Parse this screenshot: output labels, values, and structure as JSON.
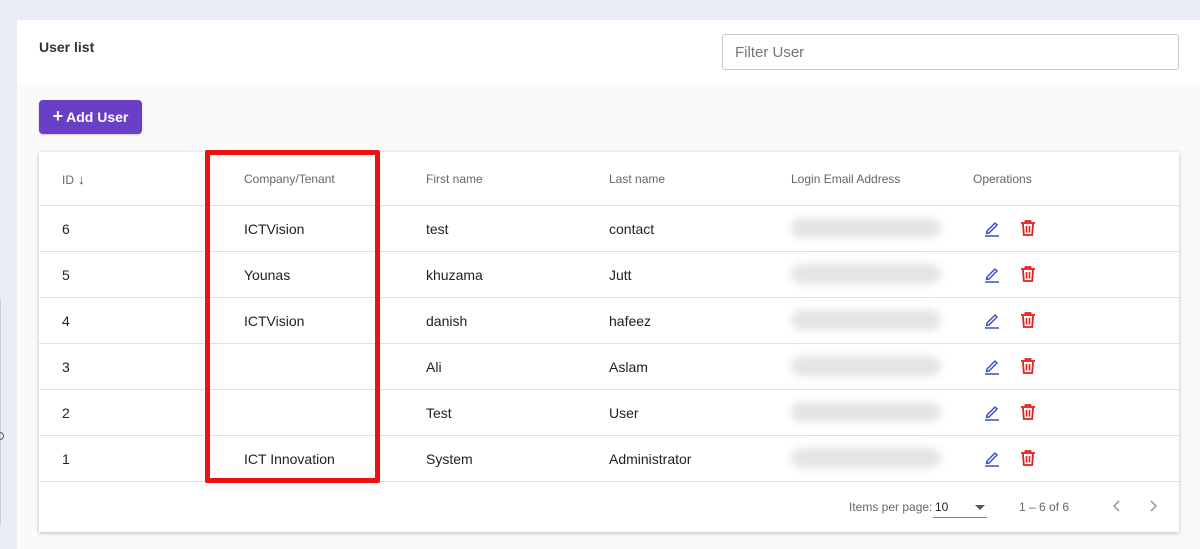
{
  "page": {
    "title": "User list"
  },
  "filter": {
    "placeholder": "Filter User"
  },
  "add_button": {
    "label": "Add User"
  },
  "table": {
    "headers": {
      "id": "ID",
      "company": "Company/Tenant",
      "first_name": "First name",
      "last_name": "Last name",
      "email": "Login Email Address",
      "operations": "Operations"
    },
    "sort_icon": "arrow-down-icon",
    "rows": [
      {
        "id": "6",
        "company": "ICTVision",
        "first_name": "test",
        "last_name": "contact"
      },
      {
        "id": "5",
        "company": "Younas",
        "first_name": "khuzama",
        "last_name": "Jutt"
      },
      {
        "id": "4",
        "company": "ICTVision",
        "first_name": "danish",
        "last_name": "hafeez"
      },
      {
        "id": "3",
        "company": "",
        "first_name": "Ali",
        "last_name": "Aslam"
      },
      {
        "id": "2",
        "company": "",
        "first_name": "Test",
        "last_name": "User"
      },
      {
        "id": "1",
        "company": "ICT Innovation",
        "first_name": "System",
        "last_name": "Administrator"
      }
    ]
  },
  "pagination": {
    "items_per_page_label": "Items per page:",
    "items_per_page_value": "10",
    "range_label": "1 – 6 of 6"
  },
  "colors": {
    "accent": "#6a3fc8",
    "edit_icon": "#3f51b5",
    "delete_icon": "#e0201c",
    "highlight": "#ee1111"
  },
  "icons": {
    "add": "plus-icon",
    "edit": "pencil-edit-icon",
    "delete": "trash-icon",
    "prev": "chevron-left-icon",
    "next": "chevron-right-icon"
  }
}
